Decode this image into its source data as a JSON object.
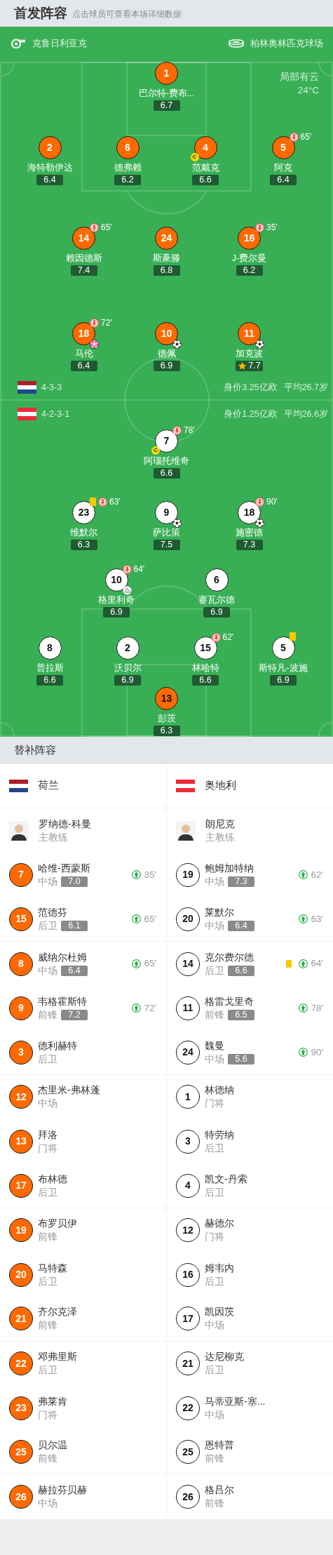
{
  "header": {
    "title": "首发阵容",
    "hint": "点击球员可查看本场详细数据"
  },
  "match_info": {
    "referee": "克鲁日利亚克",
    "venue": "柏林奥林匹克球场",
    "weather": "局部有云",
    "temperature": "24°C"
  },
  "substitutes_header": "替补阵容",
  "teams": [
    {
      "name": "荷兰",
      "flag": {
        "kind": "netherlands"
      },
      "color": "#ff6a00",
      "formation": "4-3-3",
      "market_value": "身价3.25亿欧",
      "average_age": "平均26.7岁",
      "lines": [
        [
          {
            "number": "1",
            "name": "巴尔特-费布...",
            "rating": "6.7"
          }
        ],
        [
          {
            "number": "2",
            "name": "海特勒伊达",
            "rating": "6.4"
          },
          {
            "number": "6",
            "name": "德弗赖",
            "rating": "6.2"
          },
          {
            "number": "4",
            "name": "范戴克",
            "rating": "6.6",
            "captain_badge": "C"
          },
          {
            "number": "5",
            "name": "阿克",
            "rating": "6.4",
            "sub_off": "65'"
          }
        ],
        [
          {
            "number": "14",
            "name": "赖因德斯",
            "rating": "7.4",
            "sub_off": "65'"
          },
          {
            "number": "24",
            "name": "斯豪滕",
            "rating": "6.8"
          },
          {
            "number": "16",
            "name": "J-费尔曼",
            "rating": "6.2",
            "sub_off": "35'"
          }
        ],
        [
          {
            "number": "18",
            "name": "马伦",
            "rating": "6.4",
            "sub_off": "72'",
            "events": [
              {
                "kind": "own_goal"
              }
            ]
          },
          {
            "number": "10",
            "name": "德佩",
            "rating": "6.9",
            "events": [
              {
                "kind": "goal"
              }
            ]
          },
          {
            "number": "11",
            "name": "加克波",
            "rating": "7.7",
            "best": true,
            "events": [
              {
                "kind": "goal"
              }
            ]
          }
        ]
      ],
      "coach": {
        "name": "罗纳德-科曼",
        "role": "主教练"
      },
      "substitutes": [
        {
          "number": "7",
          "name": "哈维-西蒙斯",
          "position": "中场",
          "rating": "7.0",
          "sub_on": "35'"
        },
        {
          "number": "15",
          "name": "范德芬",
          "position": "后卫",
          "rating": "6.1",
          "sub_on": "65'"
        },
        {
          "number": "8",
          "name": "威纳尔杜姆",
          "position": "中场",
          "rating": "6.4",
          "sub_on": "65'"
        },
        {
          "number": "9",
          "name": "韦格霍斯特",
          "position": "前锋",
          "rating": "7.2",
          "sub_on": "72'"
        },
        {
          "number": "3",
          "name": "德利赫特",
          "position": "后卫"
        },
        {
          "number": "12",
          "name": "杰里米-弗林蓬",
          "position": "中场"
        },
        {
          "number": "13",
          "name": "拜洛",
          "position": "门将"
        },
        {
          "number": "17",
          "name": "布林德",
          "position": "后卫"
        },
        {
          "number": "19",
          "name": "布罗贝伊",
          "position": "前锋"
        },
        {
          "number": "20",
          "name": "马特森",
          "position": "后卫"
        },
        {
          "number": "21",
          "name": "齐尔克泽",
          "position": "前锋"
        },
        {
          "number": "22",
          "name": "邓弗里斯",
          "position": "后卫"
        },
        {
          "number": "23",
          "name": "弗莱肯",
          "position": "门将"
        },
        {
          "number": "25",
          "name": "贝尔温",
          "position": "前锋"
        },
        {
          "number": "26",
          "name": "赫拉芬贝赫",
          "position": "中场"
        }
      ]
    },
    {
      "name": "奥地利",
      "flag": {
        "kind": "austria"
      },
      "color": "#ffffff",
      "formation": "4-2-3-1",
      "market_value": "身价1.25亿欧",
      "average_age": "平均26.6岁",
      "lines": [
        [
          {
            "number": "7",
            "name": "阿瑙托维奇",
            "rating": "6.6",
            "captain_badge": "C",
            "sub_off": "78'"
          }
        ],
        [
          {
            "number": "23",
            "name": "维默尔",
            "rating": "6.3",
            "sub_off": "63'",
            "events": [
              {
                "kind": "yellow_card"
              }
            ]
          },
          {
            "number": "9",
            "name": "萨比策",
            "rating": "7.5",
            "events": [
              {
                "kind": "goal"
              }
            ]
          },
          {
            "number": "18",
            "name": "施密德",
            "rating": "7.3",
            "sub_off": "90'",
            "events": [
              {
                "kind": "goal"
              }
            ]
          }
        ],
        [
          {
            "number": "10",
            "name": "格里利奇",
            "rating": "6.9",
            "sub_off": "64'",
            "events": [
              {
                "kind": "assist"
              }
            ]
          },
          {
            "number": "6",
            "name": "赛瓦尔德",
            "rating": "6.9"
          }
        ],
        [
          {
            "number": "8",
            "name": "普拉斯",
            "rating": "6.6"
          },
          {
            "number": "2",
            "name": "沃贝尔",
            "rating": "6.9"
          },
          {
            "number": "15",
            "name": "林哈特",
            "rating": "6.6",
            "sub_off": "62'"
          },
          {
            "number": "5",
            "name": "斯特凡-波施",
            "rating": "6.9",
            "events": [
              {
                "kind": "yellow_card"
              }
            ]
          }
        ],
        [
          {
            "number": "13",
            "name": "彭茨",
            "rating": "6.3",
            "color": "#ff6a00"
          }
        ]
      ],
      "coach": {
        "name": "朗尼克",
        "role": "主教练"
      },
      "substitutes": [
        {
          "number": "19",
          "name": "鲍姆加特纳",
          "position": "中场",
          "rating": "7.3",
          "sub_on": "62'"
        },
        {
          "number": "20",
          "name": "莱默尔",
          "position": "中场",
          "rating": "6.4",
          "sub_on": "63'"
        },
        {
          "number": "14",
          "name": "克尔费尔德",
          "position": "后卫",
          "rating": "6.6",
          "sub_on": "64'",
          "events": [
            {
              "kind": "yellow_card"
            }
          ]
        },
        {
          "number": "11",
          "name": "格雷戈里奇",
          "position": "前锋",
          "rating": "6.5",
          "sub_on": "78'"
        },
        {
          "number": "24",
          "name": "魏曼",
          "position": "中场",
          "rating": "5.6",
          "sub_on": "90'"
        },
        {
          "number": "1",
          "name": "林德纳",
          "position": "门将"
        },
        {
          "number": "3",
          "name": "特劳纳",
          "position": "后卫"
        },
        {
          "number": "4",
          "name": "凯文-丹索",
          "position": "后卫"
        },
        {
          "number": "12",
          "name": "赫德尔",
          "position": "门将"
        },
        {
          "number": "16",
          "name": "姆韦内",
          "position": "后卫"
        },
        {
          "number": "17",
          "name": "凯因茨",
          "position": "中场"
        },
        {
          "number": "21",
          "name": "达尼柳克",
          "position": "后卫"
        },
        {
          "number": "22",
          "name": "马蒂亚斯-塞...",
          "position": "中场"
        },
        {
          "number": "25",
          "name": "恩特普",
          "position": "前锋"
        },
        {
          "number": "26",
          "name": "格吕尔",
          "position": "前锋"
        }
      ]
    }
  ]
}
